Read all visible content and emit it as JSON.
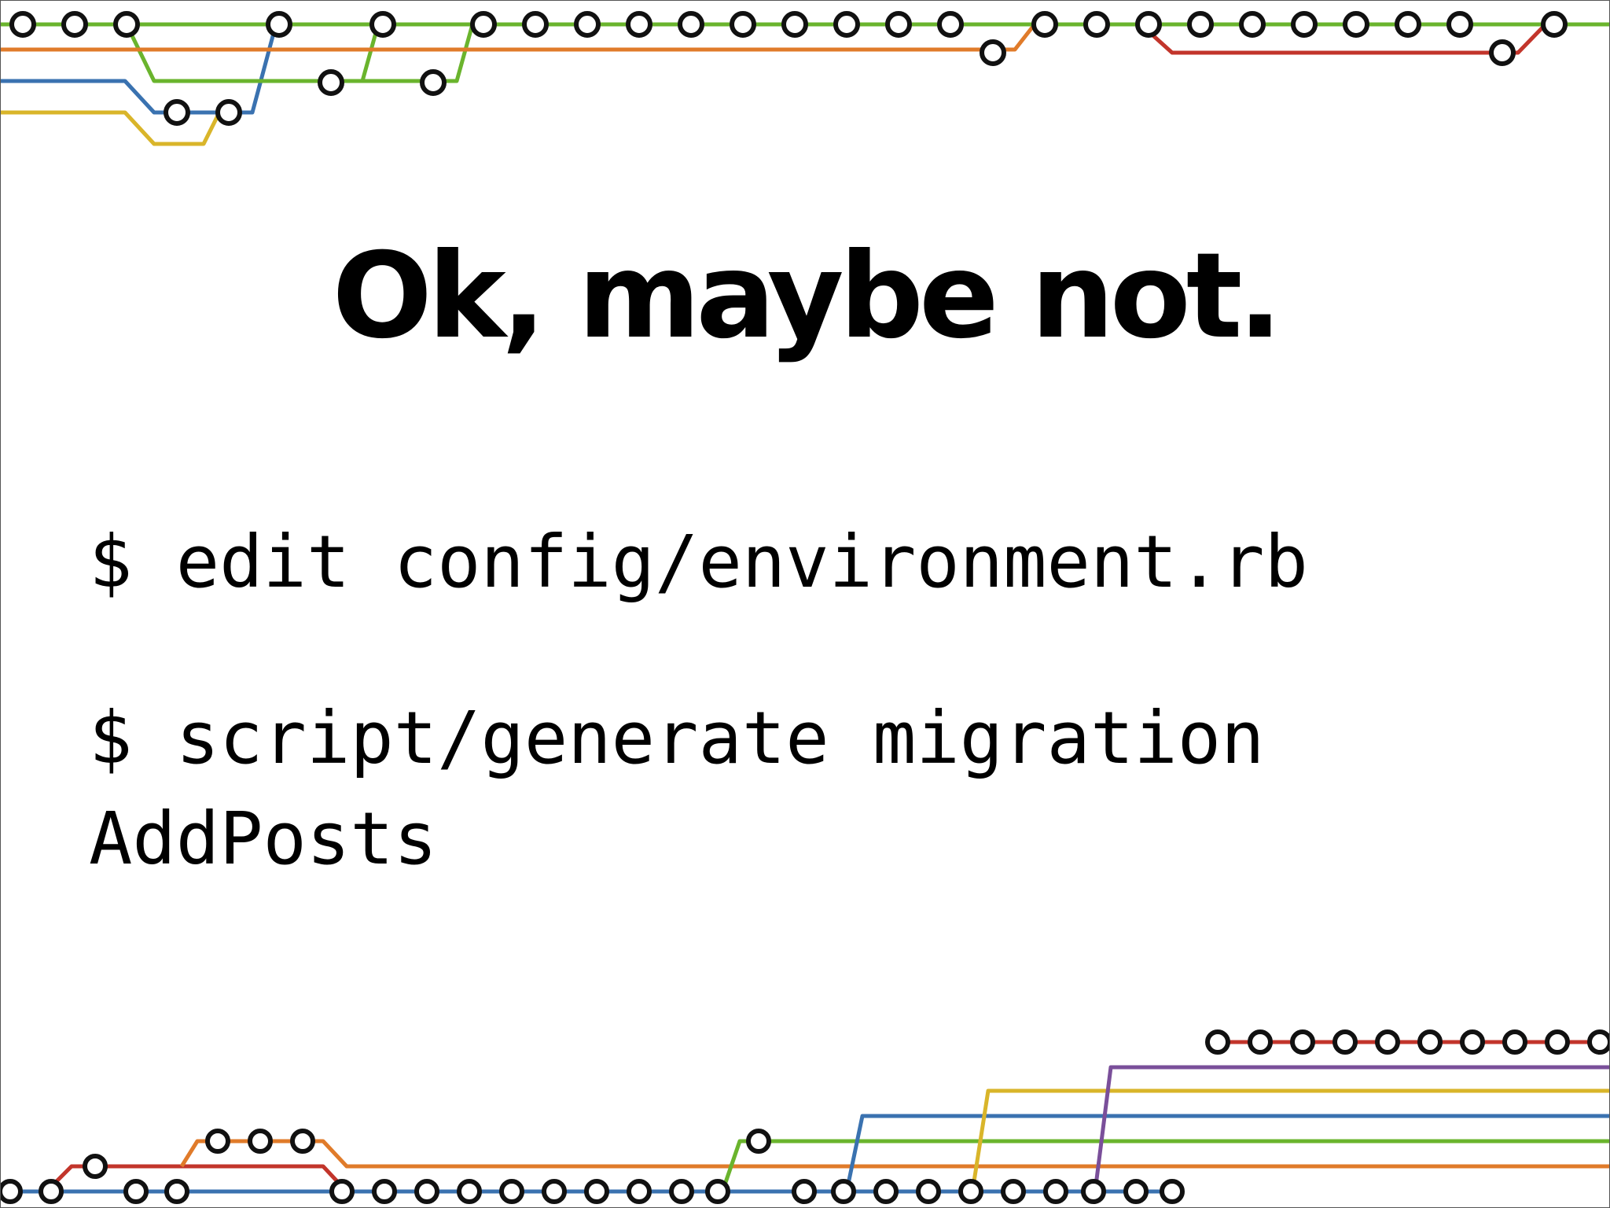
{
  "slide": {
    "title": "Ok, maybe not.",
    "commands": [
      "$ edit config/environment.rb",
      "$ script/generate migration\nAddPosts"
    ]
  },
  "decoration": {
    "description_icon": "git-branch-graph",
    "colors": {
      "green": "#6ab42d",
      "orange": "#e07b2a",
      "blue": "#3a72b0",
      "yellow": "#d9b52a",
      "red": "#c2352b",
      "purple": "#7a4f9a",
      "node_stroke": "#111111",
      "node_fill": "#ffffff"
    }
  }
}
